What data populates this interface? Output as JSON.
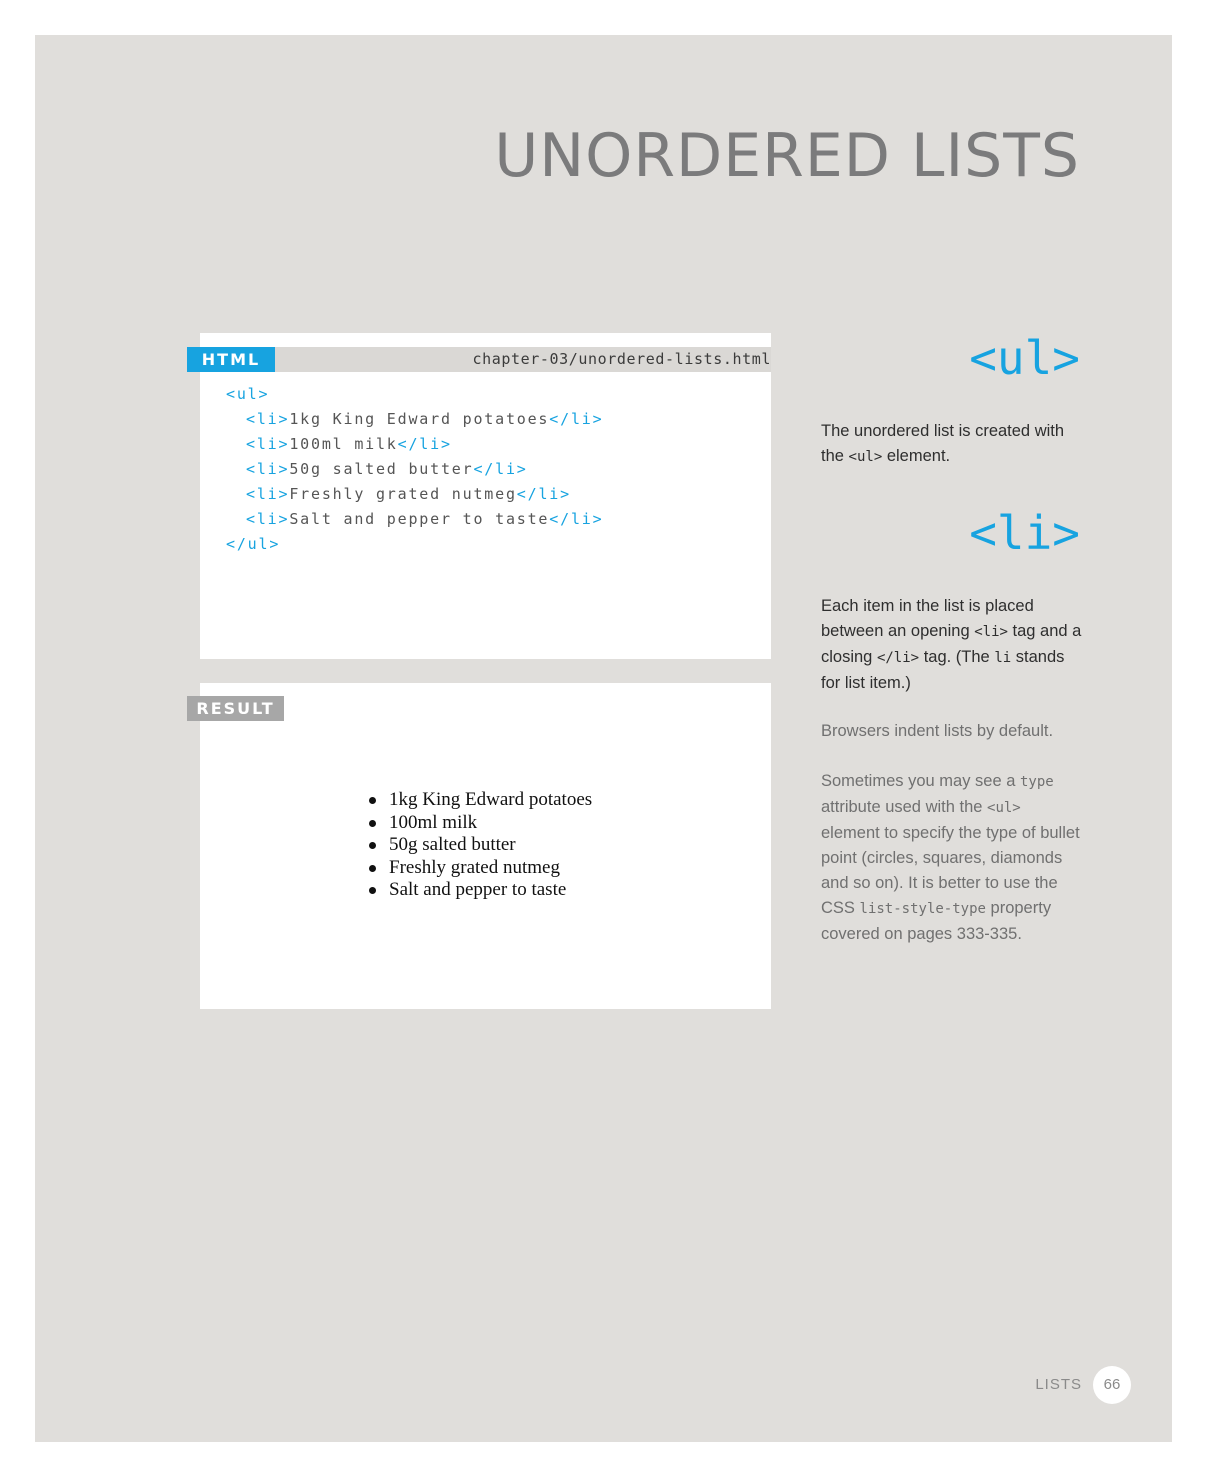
{
  "page": {
    "title": "UNORDERED LISTS"
  },
  "code_example": {
    "tab_label": "HTML",
    "filename": "chapter-03/unordered-lists.html",
    "open_ul": "<ul>",
    "close_ul": "</ul>",
    "open_li": "<li>",
    "close_li": "</li>",
    "items": [
      "1kg King Edward potatoes",
      "100ml milk",
      "50g salted butter",
      "Freshly grated nutmeg",
      "Salt and pepper to taste"
    ]
  },
  "result": {
    "tab_label": "RESULT",
    "items": [
      "1kg King Edward potatoes",
      "100ml milk",
      "50g salted butter",
      "Freshly grated nutmeg",
      "Salt and pepper to taste"
    ]
  },
  "sidebar": {
    "ul_heading": "<ul>",
    "ul_text_1": "The unordered list is created with the ",
    "ul_text_code": "<ul>",
    "ul_text_2": " element.",
    "li_heading": "<li>",
    "li_text_1": "Each item in the list is placed between an opening ",
    "li_text_code_1": "<li>",
    "li_text_2": " tag and a closing ",
    "li_text_code_2": "</li>",
    "li_text_3": " tag. (The ",
    "li_text_code_3": "li",
    "li_text_4": " stands for list item.)",
    "indent_note": "Browsers indent lists by default.",
    "type_note_1": "Sometimes you may see a ",
    "type_note_code_1": "type",
    "type_note_2": " attribute used with the ",
    "type_note_code_2": "<ul>",
    "type_note_3": " element to specify the type of bullet point (circles, squares, diamonds and so on). It is better to use the CSS ",
    "type_note_code_3": "list-style-type",
    "type_note_4": " property covered on pages 333-335."
  },
  "footer": {
    "section": "LISTS",
    "page_number": "66"
  }
}
